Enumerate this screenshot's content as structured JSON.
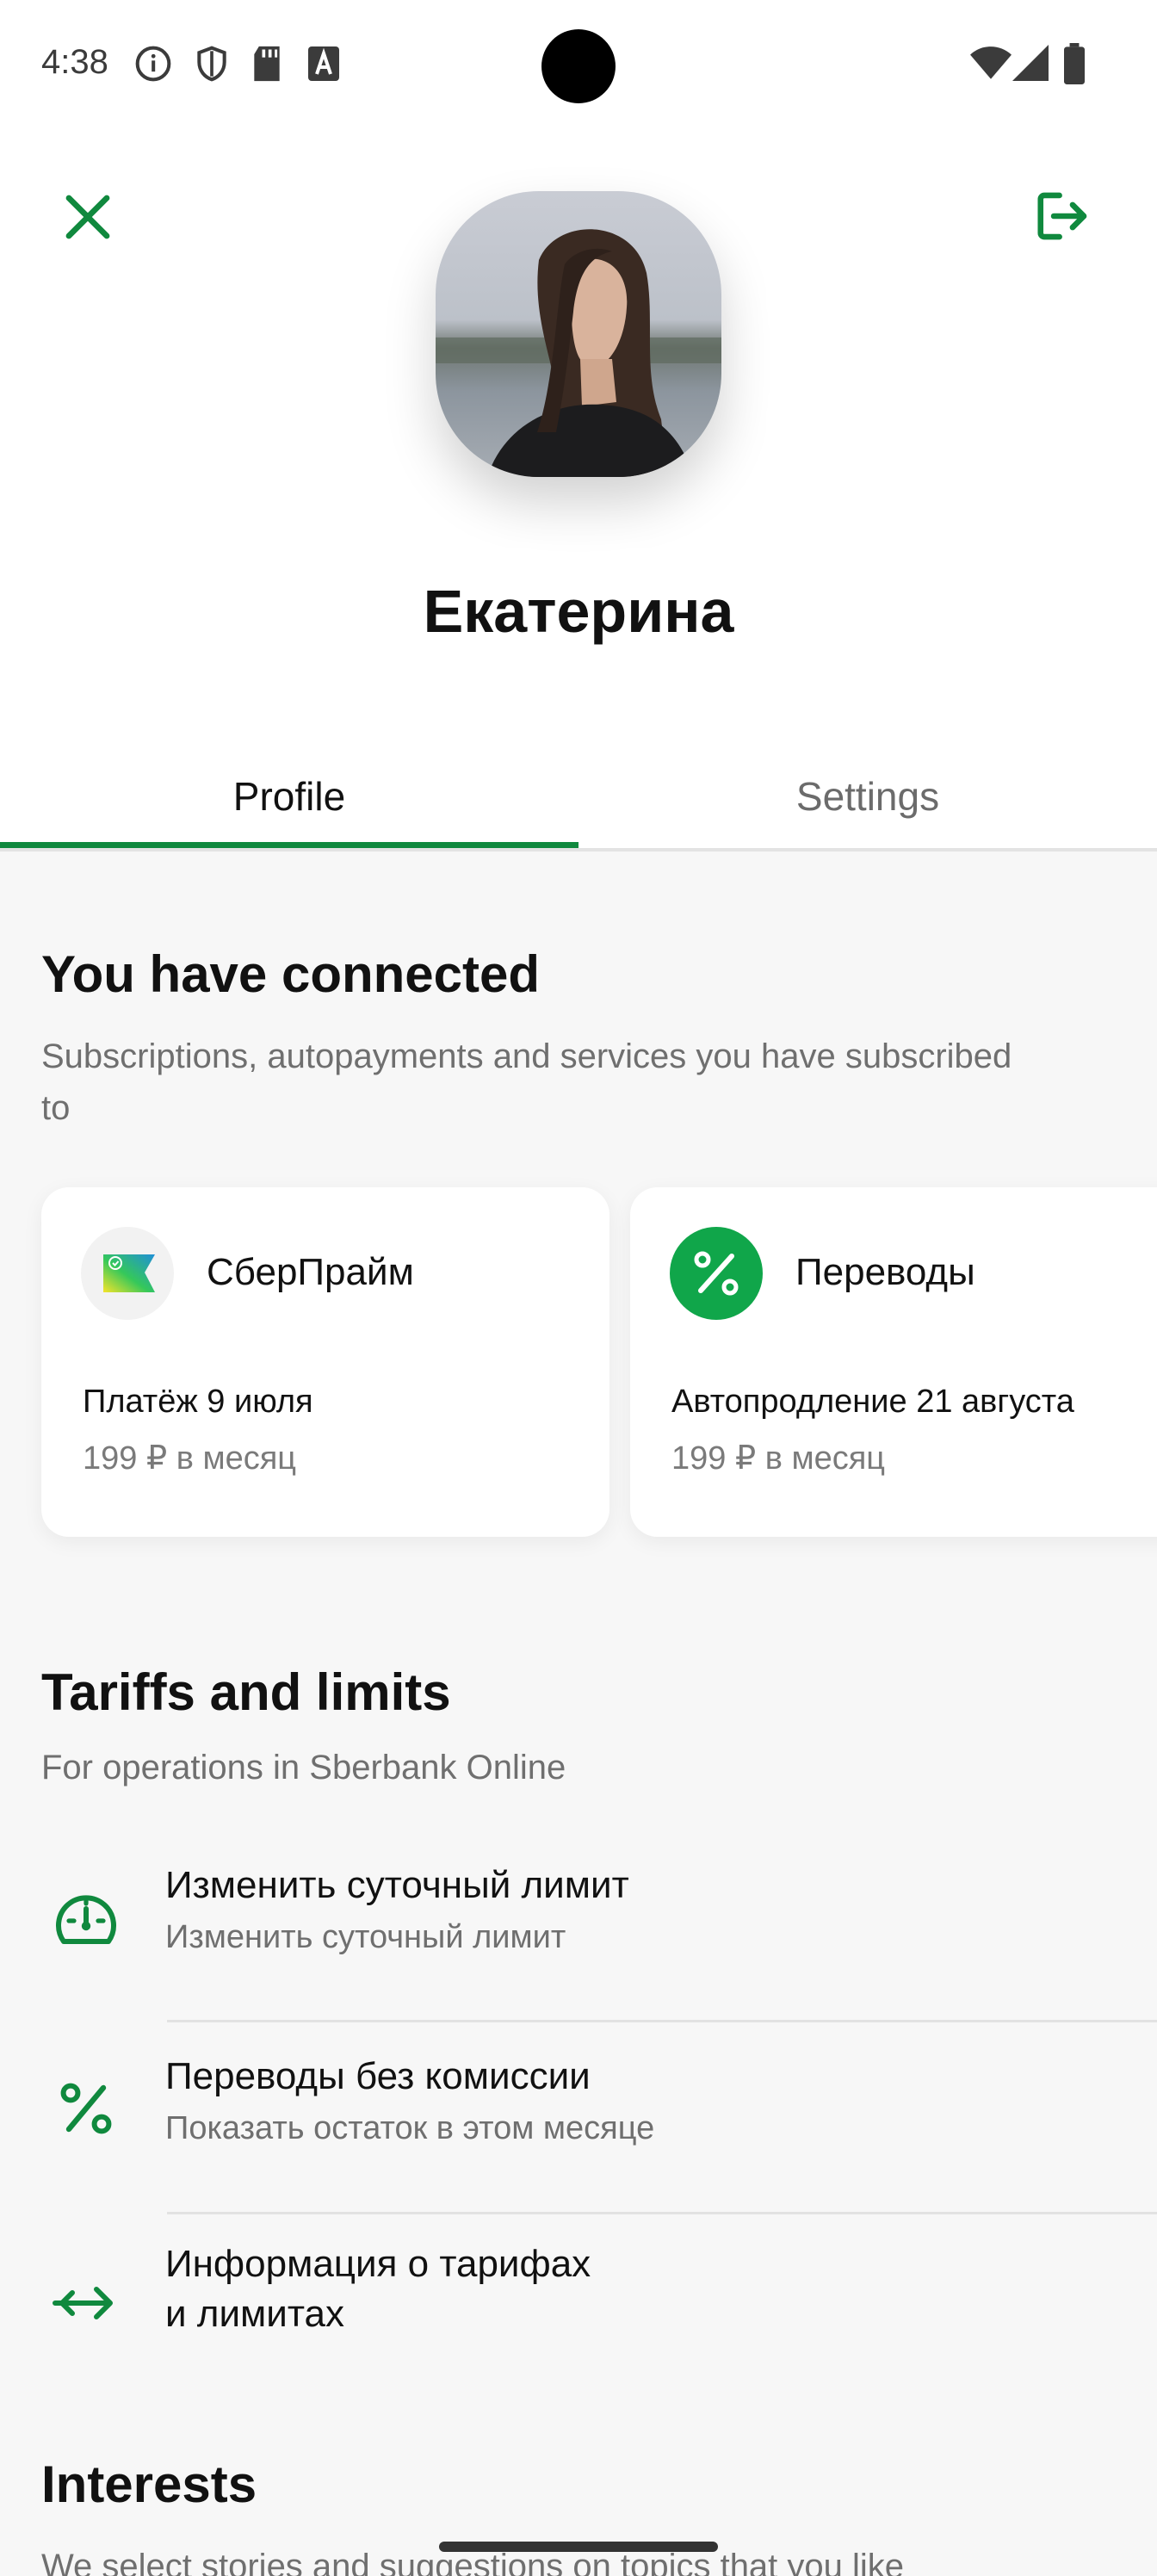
{
  "status_bar": {
    "time": "4:38",
    "left_icons": [
      "info-icon",
      "shield-icon",
      "sd-card-icon",
      "font-a-icon"
    ],
    "right_icons": [
      "wifi-icon",
      "signal-icon",
      "battery-icon"
    ]
  },
  "header": {
    "name": "Екатерина",
    "close_icon": "close-icon",
    "logout_icon": "logout-icon"
  },
  "tabs": [
    {
      "label": "Profile",
      "active": true
    },
    {
      "label": "Settings",
      "active": false
    }
  ],
  "connected": {
    "title": "You have connected",
    "subtitle_line1": "Subscriptions, autopayments and services you have subscribed",
    "subtitle_line2": "to",
    "cards": [
      {
        "title": "СберПрайм",
        "line1": "Платёж 9 июля",
        "line2": "199 ₽ в месяц",
        "icon": "sberprime-logo"
      },
      {
        "title": "Переводы",
        "line1": "Автопродление 21 августа",
        "line2": "199 ₽ в месяц",
        "icon": "percent-icon"
      }
    ]
  },
  "tariffs": {
    "title": "Tariffs and limits",
    "subtitle": "For operations in Sberbank Online",
    "items": [
      {
        "title": "Изменить суточный лимит",
        "subtitle": "Изменить суточный лимит",
        "icon": "speedometer-icon"
      },
      {
        "title": "Переводы без комиссии",
        "subtitle": "Показать остаток в этом месяце",
        "icon": "percent-icon"
      },
      {
        "title_line1": "Информация о тарифах",
        "title_line2": "и лимитах",
        "icon": "arrows-icon"
      }
    ]
  },
  "interests": {
    "title": "Interests",
    "subtitle": "We select stories and suggestions on topics that you like"
  },
  "colors": {
    "accent_green": "#10893e",
    "text_primary": "#111111",
    "text_secondary": "#6f6f6f",
    "content_bg": "#f7f7f7"
  }
}
